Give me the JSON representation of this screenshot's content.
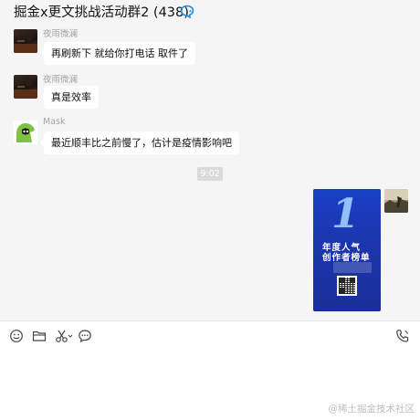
{
  "header": {
    "title": "掘金x更文挑战活动群2 (438)",
    "icon": "chat-bubble-icon"
  },
  "messages": [
    {
      "sender": "夜雨微澜",
      "text": "再刷新下 就给你打电话 取件了",
      "avatar": "dark-photo-avatar"
    },
    {
      "sender": "夜雨微澜",
      "text": "真是效率",
      "avatar": "dark-photo-avatar"
    },
    {
      "sender": "Mask",
      "text": "最近顺丰比之前慢了，估计是疫情影响吧",
      "avatar": "mask-cartoon-avatar"
    }
  ],
  "timestamp": "9:02",
  "image_message": {
    "avatar": "landscape-photo-avatar",
    "poster": {
      "big_number": "1",
      "line1": "年度人气",
      "line2": "创作者榜单"
    }
  },
  "toolbar": {
    "emoji": "emoji-icon",
    "file": "folder-icon",
    "screenshot": "scissors-icon",
    "chat_history": "speech-bubble-icon",
    "call": "phone-icon"
  },
  "watermark": "@稀土掘金技术社区",
  "colors": {
    "background": "#f5f5f5",
    "bubble": "#ffffff",
    "accent": "#1f62e0"
  }
}
